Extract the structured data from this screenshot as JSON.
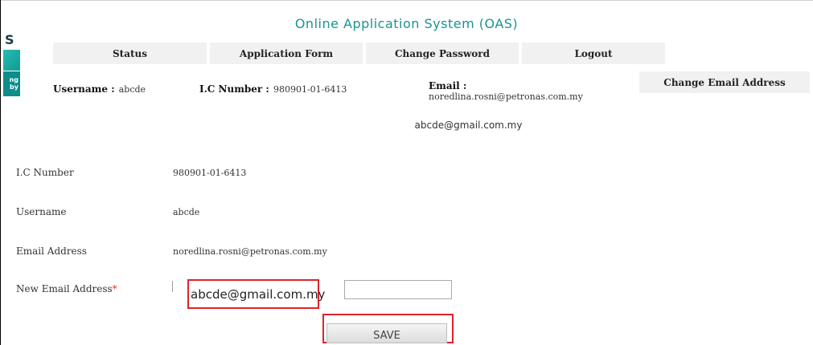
{
  "header": {
    "title": "Online Application System (OAS)",
    "logo_letter": "S",
    "logo_badge_text": "ng\nby"
  },
  "nav": {
    "items": [
      {
        "label": "Status"
      },
      {
        "label": "Application Form"
      },
      {
        "label": "Change Password"
      },
      {
        "label": "Logout"
      }
    ]
  },
  "user_info": {
    "username_label": "Username :",
    "username_value": "abcde",
    "ic_label": "I.C Number :",
    "ic_value": "980901-01-6413",
    "email_label": "Email :",
    "email_value": "noredlina.rosni@petronas.com.my",
    "change_email_button": "Change Email Address"
  },
  "preview_email": "abcde@gmail.com.my",
  "form": {
    "ic_label": "I.C Number",
    "ic_value": "980901-01-6413",
    "username_label": "Username",
    "username_value": "abcde",
    "email_label": "Email Address",
    "email_value": "noredlina.rosni@petronas.com.my",
    "new_email_label": "New Email Address",
    "required_marker": "*",
    "new_email_value": "abcde@gmail.com.my",
    "save_label": "SAVE"
  },
  "colors": {
    "title": "#199393",
    "highlight": "#e0232c",
    "nav_bg": "#f1f1f1"
  }
}
